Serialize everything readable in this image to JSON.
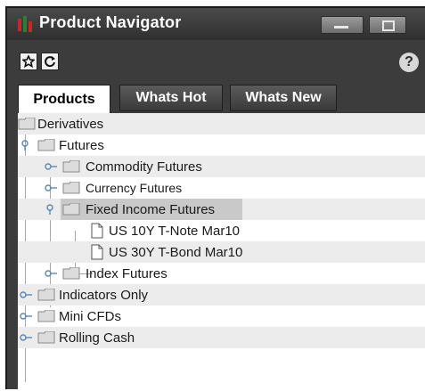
{
  "window": {
    "title": "Product Navigator",
    "controls": [
      "minimize-icon",
      "restore-icon"
    ]
  },
  "toolbar": {
    "favorite_icon": "star-icon",
    "refresh_icon": "refresh-icon",
    "help_label": "?"
  },
  "tabs": [
    {
      "label": "Products",
      "active": true
    },
    {
      "label": "Whats Hot",
      "active": false
    },
    {
      "label": "Whats New",
      "active": false
    }
  ],
  "tree": [
    {
      "label": "Derivatives",
      "type": "folder",
      "expanded": true,
      "level": 0
    },
    {
      "label": "Futures",
      "type": "folder",
      "expanded": true,
      "level": 1
    },
    {
      "label": "Commodity Futures",
      "type": "folder",
      "expanded": false,
      "level": 2
    },
    {
      "label": "Currency Futures",
      "type": "folder",
      "expanded": false,
      "level": 2
    },
    {
      "label": "Fixed Income Futures",
      "type": "folder",
      "expanded": true,
      "selected": true,
      "level": 2
    },
    {
      "label": "US 10Y T-Note Mar10",
      "type": "document",
      "level": 3
    },
    {
      "label": "US 30Y T-Bond Mar10",
      "type": "document",
      "level": 3
    },
    {
      "label": "Index Futures",
      "type": "folder",
      "expanded": false,
      "level": 2
    },
    {
      "label": "Indicators Only",
      "type": "folder",
      "expanded": false,
      "level": 1
    },
    {
      "label": "Mini CFDs",
      "type": "folder",
      "expanded": false,
      "level": 1
    },
    {
      "label": "Rolling Cash",
      "type": "folder",
      "expanded": false,
      "level": 1
    }
  ],
  "colors": {
    "window_frame": "#3c3c3c",
    "selected_row": "#c9c9c9",
    "alt_row": "#ececec",
    "connector": "#7a9bb8"
  }
}
